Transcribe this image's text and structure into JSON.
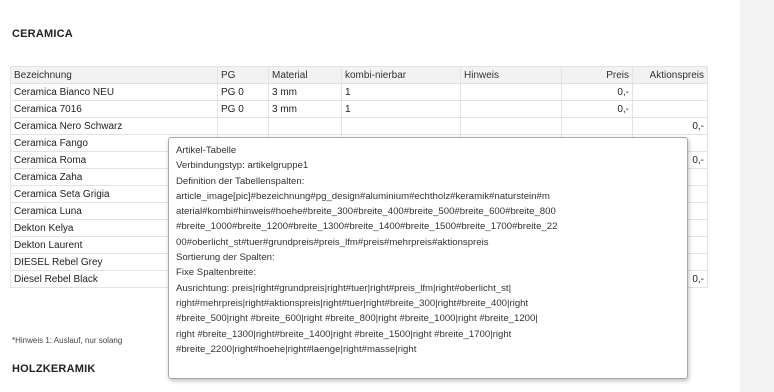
{
  "section1_title": "CERAMICA",
  "section2_title": "HOLZKERAMIK",
  "table": {
    "headers": [
      "Bezeichnung",
      "PG",
      "Material",
      "kombi-nierbar",
      "Hinweis",
      "Preis",
      "Aktionspreis"
    ],
    "rows": [
      [
        "Ceramica Bianco NEU",
        "PG 0",
        "3 mm",
        "1",
        "",
        "0,-",
        ""
      ],
      [
        "Ceramica 7016",
        "PG 0",
        "3 mm",
        "1",
        "",
        "0,-",
        ""
      ],
      [
        "Ceramica Nero Schwarz",
        "",
        "",
        "",
        "",
        "",
        "0,-"
      ],
      [
        "Ceramica Fango",
        "",
        "",
        "",
        "",
        "",
        ""
      ],
      [
        "Ceramica Roma",
        "",
        "",
        "",
        "",
        "",
        "0,-"
      ],
      [
        "Ceramica Zaha",
        "",
        "",
        "",
        "",
        "",
        ""
      ],
      [
        "Ceramica Seta Grigia",
        "",
        "",
        "",
        "",
        "",
        ""
      ],
      [
        "Ceramica Luna",
        "",
        "",
        "",
        "",
        "",
        ""
      ],
      [
        "Dekton Kelya",
        "",
        "",
        "",
        "",
        "",
        ""
      ],
      [
        "Dekton Laurent",
        "",
        "",
        "",
        "",
        "",
        ""
      ],
      [
        "DIESEL Rebel Grey",
        "",
        "",
        "",
        "",
        "",
        ""
      ],
      [
        "Diesel Rebel Black",
        "",
        "",
        "",
        "",
        "",
        "0,-"
      ]
    ]
  },
  "footnote": "*Hinweis 1: Auslauf, nur solang",
  "tooltip": {
    "lines": [
      "Artikel-Tabelle",
      "Verbindungstyp: artikelgruppe1",
      "Definition der Tabellenspalten:",
      "article_image[pic]#bezeichnung#pg_design#aluminium#echtholz#keramik#naturstein#m",
      "aterial#kombi#hinweis#hoehe#breite_300#breite_400#breite_500#breite_600#breite_800",
      "#breite_1000#breite_1200#breite_1300#breite_1400#breite_1500#breite_1700#breite_22",
      "00#oberlicht_st#tuer#grundpreis#preis_lfm#preis#mehrpreis#aktionspreis",
      "Sortierung der Spalten:",
      "Fixe Spaltenbreite:",
      "Ausrichtung: preis|right#grundpreis|right#tuer|right#preis_lfm|right#oberlicht_st|",
      "right#mehrpreis|right#aktionspreis|right#tuer|right#breite_300|right#breite_400|right",
      "#breite_500|right #breite_600|right #breite_800|right #breite_1000|right #breite_1200|",
      "right #breite_1300|right#breite_1400|right #breite_1500|right #breite_1700|right",
      "#breite_2200|right#hoehe|right#laenge|right#masse|right"
    ]
  }
}
